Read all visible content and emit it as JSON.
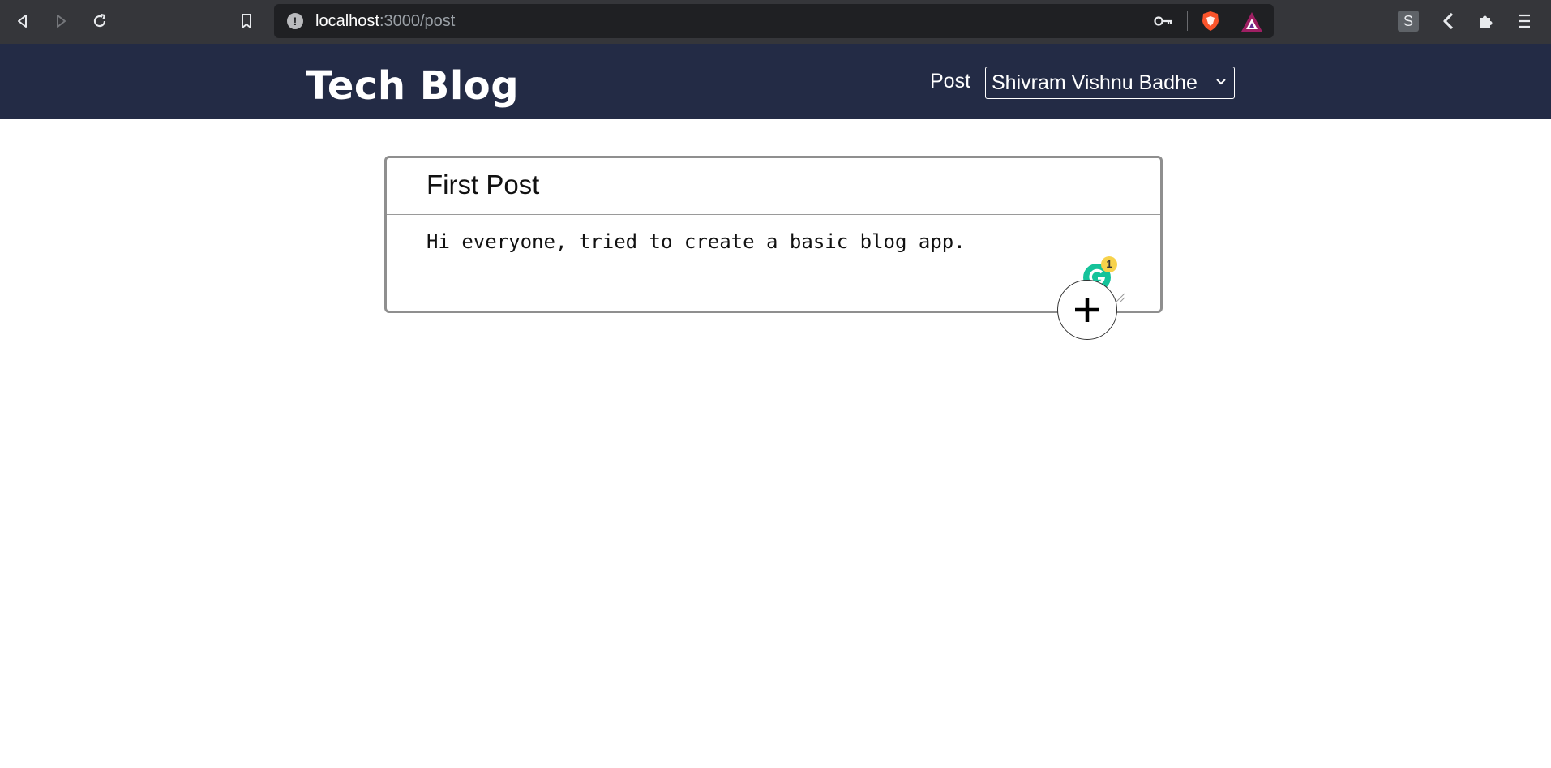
{
  "browser": {
    "url_host": "localhost",
    "url_path": ":3000/post",
    "extension_label": "S",
    "icons": [
      "back-icon",
      "forward-icon",
      "reload-icon",
      "bookmark-icon",
      "info-icon",
      "key-icon",
      "brave-shield-icon",
      "rewards-icon",
      "extensions-icon",
      "menu-icon"
    ]
  },
  "header": {
    "brand": "Tech Blog",
    "nav_post": "Post",
    "user_select_value": "Shivram Vishnu Badhe"
  },
  "post": {
    "title": "First Post",
    "body": "Hi everyone, tried to create a basic blog app."
  },
  "grammarly": {
    "count": "1"
  },
  "colors": {
    "header_bg": "#232b45",
    "browser_bg": "#35363a",
    "card_border": "#8f8f8f"
  }
}
